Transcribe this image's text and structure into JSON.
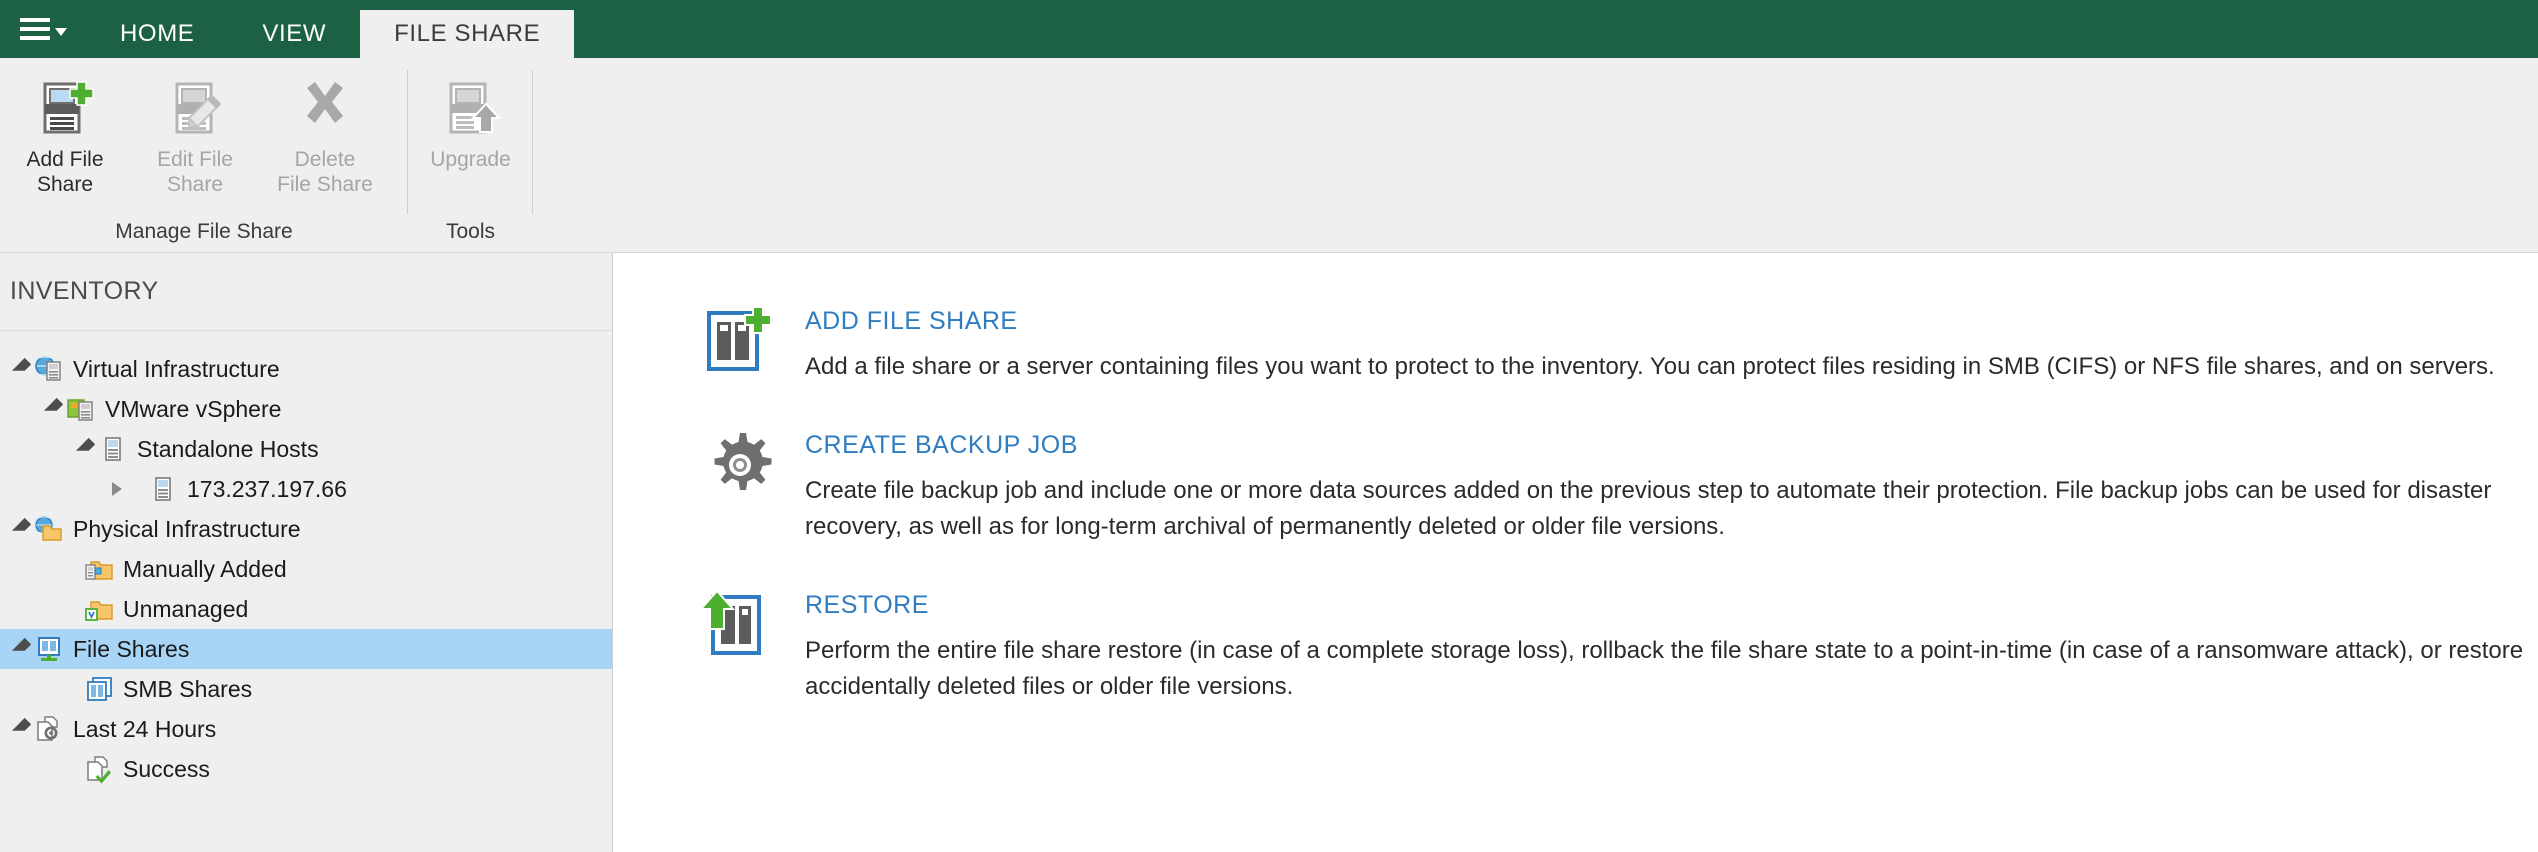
{
  "window": {
    "app_menu_icon": "hamburger-menu-icon",
    "tabs": [
      {
        "label": "HOME",
        "active": false
      },
      {
        "label": "VIEW",
        "active": false
      },
      {
        "label": "FILE SHARE",
        "active": true
      }
    ]
  },
  "ribbon": {
    "groups": [
      {
        "title": "Manage File Share",
        "buttons": [
          {
            "label_line1": "Add File",
            "label_line2": "Share",
            "icon": "add-file-share-icon",
            "disabled": false
          },
          {
            "label_line1": "Edit File",
            "label_line2": "Share",
            "icon": "edit-file-share-icon",
            "disabled": true
          },
          {
            "label_line1": "Delete",
            "label_line2": "File Share",
            "icon": "delete-file-share-icon",
            "disabled": true
          }
        ]
      },
      {
        "title": "Tools",
        "buttons": [
          {
            "label_line1": "Upgrade",
            "label_line2": "",
            "icon": "upgrade-icon",
            "disabled": true
          }
        ]
      }
    ]
  },
  "sidebar": {
    "header": "INVENTORY",
    "tree": [
      {
        "label": "Virtual Infrastructure",
        "indent": 0,
        "twist": "expanded",
        "icon": "virtual-infrastructure-icon",
        "selected": false
      },
      {
        "label": "VMware vSphere",
        "indent": 1,
        "twist": "expanded",
        "icon": "vmware-vsphere-icon",
        "selected": false
      },
      {
        "label": "Standalone Hosts",
        "indent": 2,
        "twist": "expanded",
        "icon": "host-group-icon",
        "selected": false
      },
      {
        "label": "173.237.197.66",
        "indent": 3,
        "twist": "collapsed",
        "icon": "host-icon",
        "selected": false
      },
      {
        "label": "Physical Infrastructure",
        "indent": 0,
        "twist": "expanded",
        "icon": "physical-infrastructure-icon",
        "selected": false
      },
      {
        "label": "Manually Added",
        "indent": 1,
        "twist": "none",
        "icon": "manually-added-icon",
        "selected": false
      },
      {
        "label": "Unmanaged",
        "indent": 1,
        "twist": "none",
        "icon": "unmanaged-icon",
        "selected": false
      },
      {
        "label": "File Shares",
        "indent": 0,
        "twist": "expanded",
        "icon": "file-shares-icon",
        "selected": true
      },
      {
        "label": "SMB Shares",
        "indent": 1,
        "twist": "none",
        "icon": "smb-shares-icon",
        "selected": false
      },
      {
        "label": "Last 24 Hours",
        "indent": 0,
        "twist": "expanded",
        "icon": "last-24-hours-icon",
        "selected": false
      },
      {
        "label": "Success",
        "indent": 1,
        "twist": "none",
        "icon": "success-icon",
        "selected": false
      }
    ]
  },
  "main": {
    "cards": [
      {
        "icon": "add-file-share-large-icon",
        "title": "ADD FILE SHARE",
        "description": "Add a file share or a server containing files you want to protect to the inventory. You can protect files residing in SMB (CIFS) or NFS file shares, and on servers."
      },
      {
        "icon": "create-backup-job-gear-icon",
        "title": "CREATE BACKUP JOB",
        "description": "Create file backup job and include one or more data sources added on the previous step to automate their protection. File backup jobs can be used for disaster recovery, as well as for long-term archival of permanently deleted or older file versions."
      },
      {
        "icon": "restore-large-icon",
        "title": "RESTORE",
        "description": "Perform the entire file share restore (in case of a complete storage loss), rollback the file share state to a point-in-time (in case of a ransomware attack), or restore accidentally deleted files or older file versions."
      }
    ]
  },
  "colors": {
    "ribbon_green": "#1d6145",
    "link_blue": "#2f7dc0",
    "selection_blue": "#a8d4f5",
    "chrome_gray": "#efefef",
    "accent_green": "#4caf2f"
  }
}
